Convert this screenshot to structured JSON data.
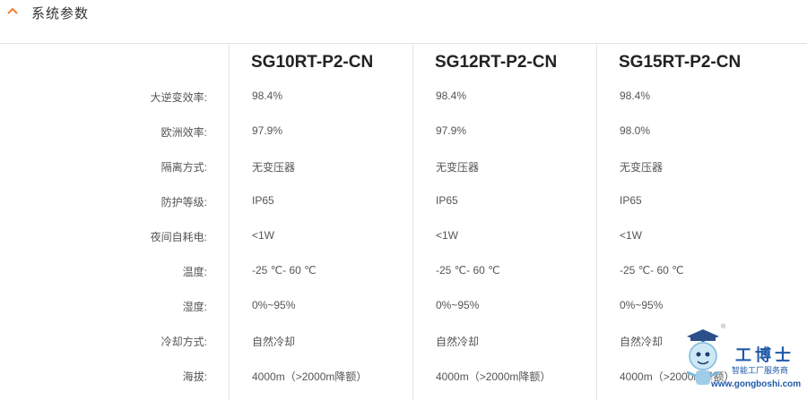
{
  "section": {
    "title": "系统参数",
    "icon": "chevron-up-icon",
    "accent_color": "#f07f2c"
  },
  "models": [
    "SG10RT-P2-CN",
    "SG12RT-P2-CN",
    "SG15RT-P2-CN"
  ],
  "rows": [
    {
      "label": "大逆变效率:",
      "values": [
        "98.4%",
        "98.4%",
        "98.4%"
      ]
    },
    {
      "label": "欧洲效率:",
      "values": [
        "97.9%",
        "97.9%",
        "98.0%"
      ]
    },
    {
      "label": "隔离方式:",
      "values": [
        "无变压器",
        "无变压器",
        "无变压器"
      ]
    },
    {
      "label": "防护等级:",
      "values": [
        "IP65",
        "IP65",
        "IP65"
      ]
    },
    {
      "label": "夜间自耗电:",
      "values": [
        "<1W",
        "<1W",
        "<1W"
      ]
    },
    {
      "label": "温度:",
      "values": [
        "-25 ℃- 60 ℃",
        "-25 ℃- 60 ℃",
        "-25 ℃- 60 ℃"
      ]
    },
    {
      "label": "湿度:",
      "values": [
        "0%~95%",
        "0%~95%",
        "0%~95%"
      ]
    },
    {
      "label": "冷却方式:",
      "values": [
        "自然冷却",
        "自然冷却",
        "自然冷却"
      ]
    },
    {
      "label": "海拔:",
      "values": [
        "4000m（>2000m降额）",
        "4000m（>2000m降额）",
        "4000m（>2000m降额）"
      ]
    }
  ],
  "watermark": {
    "name": "工博士",
    "subtitle": "智能工厂服务商",
    "url": "www.gongboshi.com",
    "registered": "®",
    "color": "#1f5aa8"
  }
}
